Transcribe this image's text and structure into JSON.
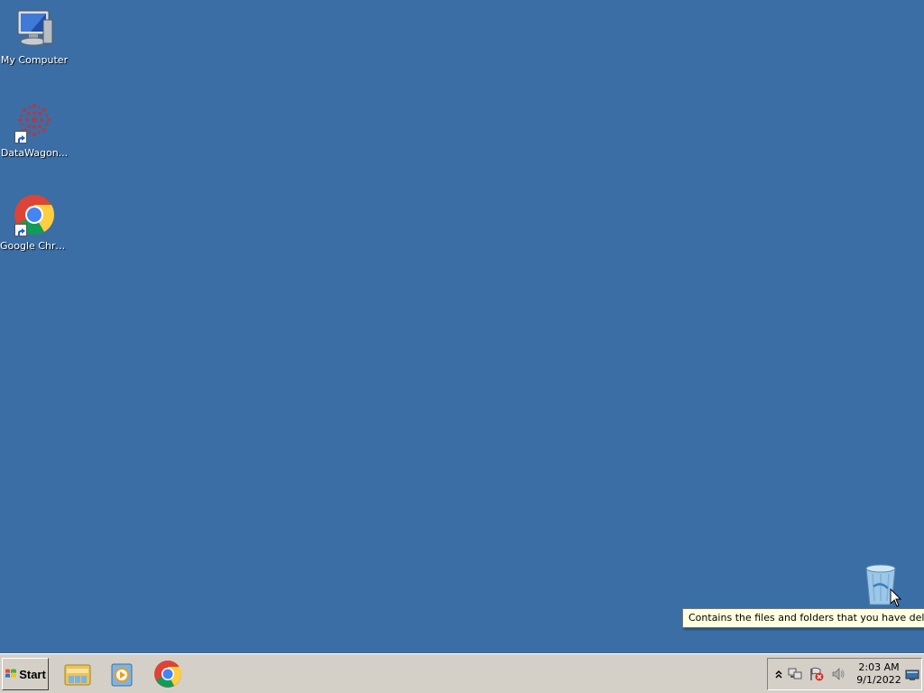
{
  "desktop": {
    "background_color": "#3a6ea5",
    "icons": [
      {
        "label": "My Computer",
        "icon": "computer-icon"
      },
      {
        "label": "DataWagon...",
        "icon": "datawagon-icon"
      },
      {
        "label": "Google Chrome",
        "icon": "chrome-icon"
      }
    ],
    "recycle_bin": {
      "icon": "recycle-bin-icon"
    },
    "tooltip": "Contains the files and folders that you have deleted."
  },
  "taskbar": {
    "start_label": "Start",
    "quick_launch": [
      {
        "icon": "file-explorer-icon"
      },
      {
        "icon": "media-player-icon"
      },
      {
        "icon": "chrome-icon"
      }
    ],
    "tray": {
      "icons": [
        "show-hidden-icons-icon",
        "network-icon",
        "action-center-icon",
        "volume-icon"
      ],
      "time": "2:03 AM",
      "date": "9/1/2022",
      "show_desktop_icon": "show-desktop-icon"
    }
  }
}
